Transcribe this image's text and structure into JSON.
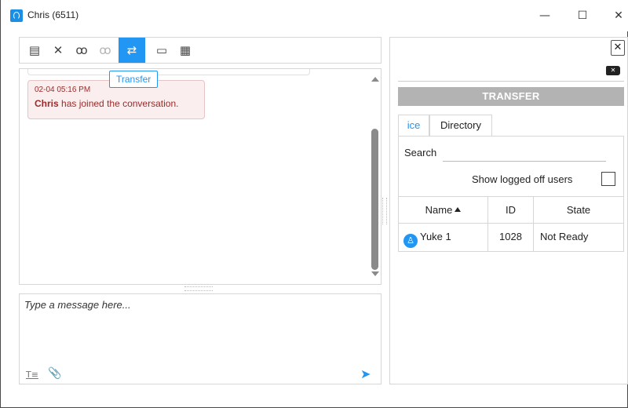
{
  "window": {
    "title": "Chris (6511)",
    "minimize_glyph": "—",
    "maximize_glyph": "☐",
    "close_glyph": "✕"
  },
  "toolbar": {
    "buttons": [
      {
        "icon": "contact-card-icon",
        "glyph": "▤"
      },
      {
        "icon": "end-chat-icon",
        "glyph": "✕"
      },
      {
        "icon": "conference-icon",
        "glyph": "ꝏ"
      },
      {
        "icon": "consult-icon",
        "glyph": "ꝏ"
      },
      {
        "icon": "transfer-icon",
        "glyph": "⇄",
        "active": true
      },
      {
        "icon": "briefcase-icon",
        "glyph": "▭"
      },
      {
        "icon": "canned-response-icon",
        "glyph": "▦"
      }
    ],
    "tooltip": "Transfer"
  },
  "chat": {
    "messages": [
      {
        "time": "02-04 05:16 PM",
        "author": "Chris",
        "text": " has joined the conversation."
      }
    ]
  },
  "composer": {
    "placeholder": "Type a message here...",
    "format_glyph": "T≡",
    "attach_glyph": "📎",
    "send_glyph": "➤"
  },
  "transfer": {
    "close_glyph": "✕",
    "clear_glyph": "✕",
    "header": "TRANSFER",
    "tabs": [
      {
        "label": "ice",
        "active": true
      },
      {
        "label": "Directory",
        "active": false
      }
    ],
    "search_label": "Search",
    "search_value": "",
    "show_logged_off_label": "Show logged off users",
    "show_logged_off_checked": false,
    "columns": [
      "Name",
      "ID",
      "State"
    ],
    "sort_column": "Name",
    "sort_direction": "asc",
    "rows": [
      {
        "name": "Yuke 1",
        "id": "1028",
        "state": "Not Ready",
        "icon": "user-icon"
      }
    ]
  },
  "colors": {
    "accent": "#2196f3",
    "system_message_text": "#9b2a2a",
    "system_message_bg": "#fbeeee",
    "header_bg": "#b3b3b3"
  }
}
